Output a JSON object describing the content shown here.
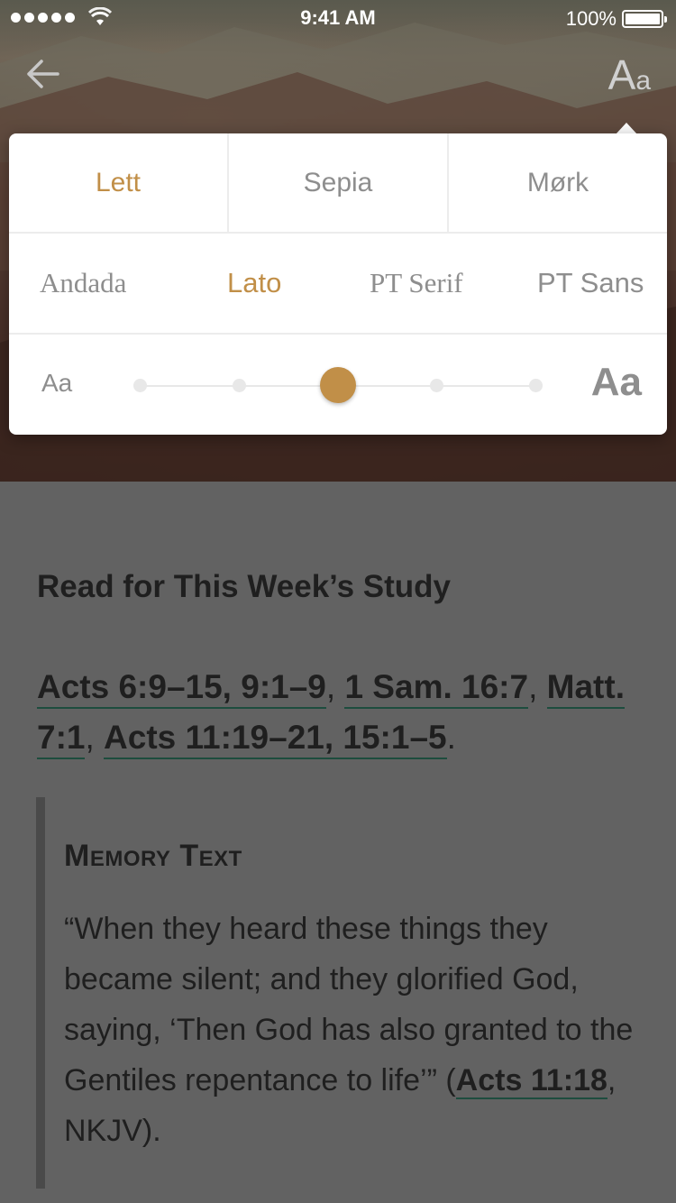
{
  "status_bar": {
    "time": "9:41 AM",
    "battery": "100%",
    "icons": [
      "signal-dots-icon",
      "wifi-icon",
      "battery-icon"
    ]
  },
  "nav": {
    "back_icon": "arrow-left-icon",
    "font_settings_big": "A",
    "font_settings_small": "a"
  },
  "reader_settings": {
    "themes": [
      {
        "label": "Lett",
        "selected": true
      },
      {
        "label": "Sepia",
        "selected": false
      },
      {
        "label": "Mørk",
        "selected": false
      }
    ],
    "fonts": [
      {
        "label": "Andada",
        "selected": false
      },
      {
        "label": "Lato",
        "selected": true
      },
      {
        "label": "PT Serif",
        "selected": false
      },
      {
        "label": "PT Sans",
        "selected": false
      }
    ],
    "size_small_label": "Aa",
    "size_large_label": "Aa",
    "size_steps": 5,
    "size_selected_index": 2,
    "accent_color": "#c18f48"
  },
  "content": {
    "section_title": "Read for This Week’s Study",
    "references": [
      {
        "text": "Acts 6:9–15, 9:1–9",
        "link": true
      },
      {
        "text": ", ",
        "link": false
      },
      {
        "text": "1 Sam. 16:7",
        "link": true
      },
      {
        "text": ", ",
        "link": false
      },
      {
        "text": "Matt. 7:1",
        "link": true
      },
      {
        "text": ", ",
        "link": false
      },
      {
        "text": "Acts 11:19–21, 15:1–5",
        "link": true
      },
      {
        "text": ".",
        "link": false
      }
    ],
    "memory_title": "Memory Text",
    "memory_quote": "“When they heard these things they became silent; and they glorified God, saying, ‘Then God has also granted to the Gentiles repentance to life’” (",
    "memory_ref": "Acts 11:18",
    "memory_suffix": ", NKJV)."
  }
}
